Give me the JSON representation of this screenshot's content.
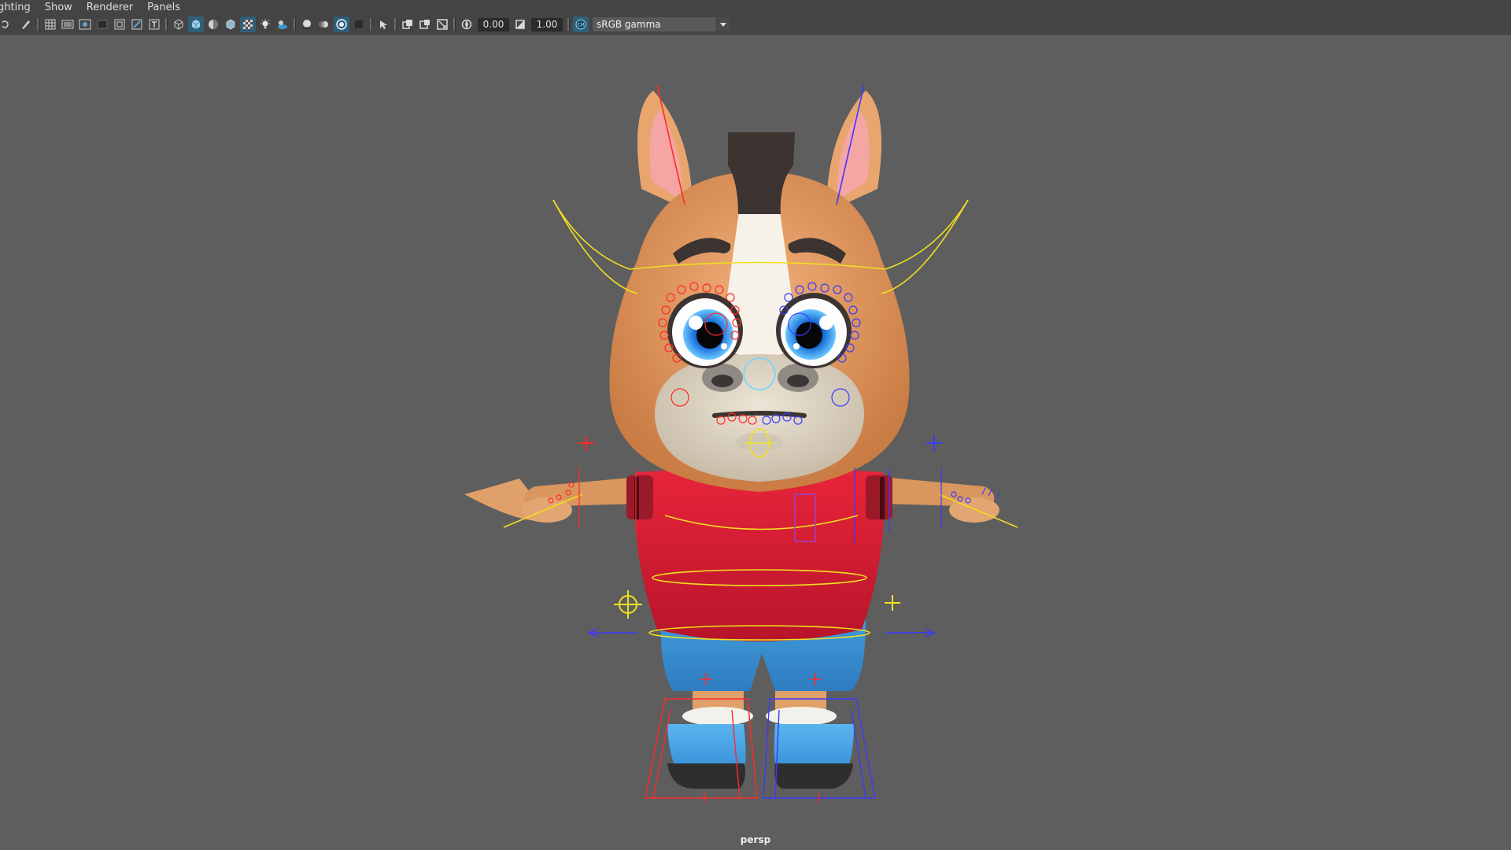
{
  "menubar": {
    "items": [
      {
        "label": "ghting"
      },
      {
        "label": "Show"
      },
      {
        "label": "Renderer"
      },
      {
        "label": "Panels"
      }
    ]
  },
  "toolbar": {
    "exposure_value": "0.00",
    "gamma_value": "1.00",
    "color_space": "sRGB gamma",
    "icons": [
      "select-camera-icon",
      "camera-attributes-icon",
      "grid-icon",
      "film-gate-icon",
      "resolution-gate-icon",
      "gate-mask-icon",
      "field-chart-icon",
      "safe-action-icon",
      "safe-title-icon",
      "wireframe-icon",
      "smooth-shade-icon",
      "default-material-icon",
      "wireframe-on-shaded-icon",
      "xray-icon",
      "use-all-lights-icon",
      "shadows-icon",
      "screen-space-ao-icon",
      "motion-blur-icon",
      "anti-aliasing-icon",
      "isolate-select-icon",
      "xray-joints-icon",
      "xray-active-icon",
      "frame-all-icon",
      "exposure-icon",
      "gamma-icon",
      "color-management-icon"
    ]
  },
  "colors": {
    "viewport_bg": "#5e5e5e",
    "ui_bg": "#444444",
    "active_button": "#2f5f79",
    "control_left": "#ff2020",
    "control_right": "#2020ff",
    "control_center": "#f0e020"
  },
  "viewport": {
    "camera_label": "persp"
  }
}
